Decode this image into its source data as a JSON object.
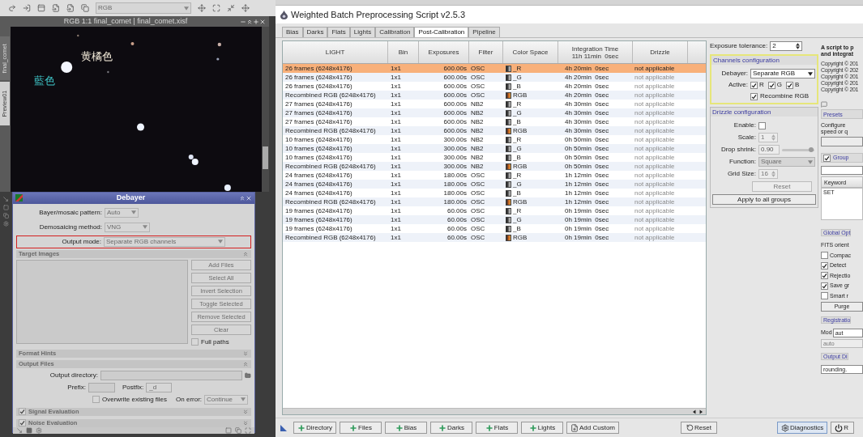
{
  "toolbar": {
    "view_selector": "RGB"
  },
  "image_window": {
    "title": "RGB 1:1 final_comet | final_comet.xisf",
    "side_tabs": [
      {
        "label": "final_comet",
        "selected": false
      },
      {
        "label": "Preview01",
        "selected": true
      }
    ],
    "annotations": [
      {
        "text": "黄橘色",
        "color": "#f2ead8"
      },
      {
        "text": "藍色",
        "color": "#3fc6c8"
      }
    ]
  },
  "debayer": {
    "title": "Debayer",
    "params": [
      {
        "label": "Bayer/mosaic pattern:",
        "value": "Auto",
        "highlighted": false
      },
      {
        "label": "Demosaicing method:",
        "value": "VNG",
        "highlighted": false
      },
      {
        "label": "Output mode:",
        "value": "Separate RGB channels",
        "highlighted": true
      }
    ],
    "target_images": {
      "title": "Target Images",
      "expanded": true,
      "buttons": [
        {
          "label": "Add Files",
          "disabled": true
        },
        {
          "label": "Select All",
          "disabled": true
        },
        {
          "label": "Invert Selection",
          "disabled": true
        },
        {
          "label": "Toggle Selected",
          "disabled": true
        },
        {
          "label": "Remove Selected",
          "disabled": true
        },
        {
          "label": "Clear",
          "disabled": true
        }
      ],
      "full_paths": {
        "label": "Full paths",
        "checked": false
      }
    },
    "format_hints": {
      "title": "Format Hints",
      "expanded": false
    },
    "output_files": {
      "title": "Output Files",
      "expanded": true,
      "directory_label": "Output directory:",
      "prefix_label": "Prefix:",
      "postfix_label": "Postfix:",
      "postfix_value": "_d",
      "overwrite": {
        "label": "Overwrite existing files",
        "checked": false
      },
      "on_error_label": "On error:",
      "on_error_value": "Continue"
    },
    "evaluations": [
      {
        "title": "Signal Evaluation",
        "checked": true,
        "expanded": false
      },
      {
        "title": "Noise Evaluation",
        "checked": true,
        "expanded": false
      }
    ]
  },
  "main_window": {
    "title": "Weighted Batch Preprocessing Script v2.5.3",
    "tabs": [
      {
        "label": "Bias",
        "selected": false
      },
      {
        "label": "Darks",
        "selected": false
      },
      {
        "label": "Flats",
        "selected": false
      },
      {
        "label": "Lights",
        "selected": false
      },
      {
        "label": "Calibration",
        "selected": false
      },
      {
        "label": "Post-Calibration",
        "selected": true
      },
      {
        "label": "Pipeline",
        "selected": false
      }
    ],
    "table": {
      "columns": [
        "LIGHT",
        "Bin",
        "Exposures",
        "Filter",
        "Color Space",
        "Integration Time",
        "Drizzle"
      ],
      "total_integration": "11h 11min  0sec",
      "rows": [
        {
          "light": "26 frames (6248x4176)",
          "bin": "1x1",
          "exposure": "600.00s",
          "filter": "OSC",
          "kind": "mono",
          "space": "_R",
          "integration": "4h 20min  0sec",
          "drizzle": "not applicable",
          "selected": true
        },
        {
          "light": "26 frames (6248x4176)",
          "bin": "1x1",
          "exposure": "600.00s",
          "filter": "OSC",
          "kind": "mono",
          "space": "_G",
          "integration": "4h 20min  0sec",
          "drizzle": "not applicable",
          "selected": false
        },
        {
          "light": "26 frames (6248x4176)",
          "bin": "1x1",
          "exposure": "600.00s",
          "filter": "OSC",
          "kind": "mono",
          "space": "_B",
          "integration": "4h 20min  0sec",
          "drizzle": "not applicable",
          "selected": false
        },
        {
          "light": "Recombined RGB (6248x4176)",
          "bin": "1x1",
          "exposure": "600.00s",
          "filter": "OSC",
          "kind": "rgb",
          "space": "RGB",
          "integration": "4h 20min  0sec",
          "drizzle": "not applicable",
          "selected": false
        },
        {
          "light": "27 frames (6248x4176)",
          "bin": "1x1",
          "exposure": "600.00s",
          "filter": "NB2",
          "kind": "mono",
          "space": "_R",
          "integration": "4h 30min  0sec",
          "drizzle": "not applicable",
          "selected": false
        },
        {
          "light": "27 frames (6248x4176)",
          "bin": "1x1",
          "exposure": "600.00s",
          "filter": "NB2",
          "kind": "mono",
          "space": "_G",
          "integration": "4h 30min  0sec",
          "drizzle": "not applicable",
          "selected": false
        },
        {
          "light": "27 frames (6248x4176)",
          "bin": "1x1",
          "exposure": "600.00s",
          "filter": "NB2",
          "kind": "mono",
          "space": "_B",
          "integration": "4h 30min  0sec",
          "drizzle": "not applicable",
          "selected": false
        },
        {
          "light": "Recombined RGB (6248x4176)",
          "bin": "1x1",
          "exposure": "600.00s",
          "filter": "NB2",
          "kind": "rgb",
          "space": "RGB",
          "integration": "4h 30min  0sec",
          "drizzle": "not applicable",
          "selected": false
        },
        {
          "light": "10 frames (6248x4176)",
          "bin": "1x1",
          "exposure": "300.00s",
          "filter": "NB2",
          "kind": "mono",
          "space": "_R",
          "integration": "0h 50min  0sec",
          "drizzle": "not applicable",
          "selected": false
        },
        {
          "light": "10 frames (6248x4176)",
          "bin": "1x1",
          "exposure": "300.00s",
          "filter": "NB2",
          "kind": "mono",
          "space": "_G",
          "integration": "0h 50min  0sec",
          "drizzle": "not applicable",
          "selected": false
        },
        {
          "light": "10 frames (6248x4176)",
          "bin": "1x1",
          "exposure": "300.00s",
          "filter": "NB2",
          "kind": "mono",
          "space": "_B",
          "integration": "0h 50min  0sec",
          "drizzle": "not applicable",
          "selected": false
        },
        {
          "light": "Recombined RGB (6248x4176)",
          "bin": "1x1",
          "exposure": "300.00s",
          "filter": "NB2",
          "kind": "rgb",
          "space": "RGB",
          "integration": "0h 50min  0sec",
          "drizzle": "not applicable",
          "selected": false
        },
        {
          "light": "24 frames (6248x4176)",
          "bin": "1x1",
          "exposure": "180.00s",
          "filter": "OSC",
          "kind": "mono",
          "space": "_R",
          "integration": "1h 12min  0sec",
          "drizzle": "not applicable",
          "selected": false
        },
        {
          "light": "24 frames (6248x4176)",
          "bin": "1x1",
          "exposure": "180.00s",
          "filter": "OSC",
          "kind": "mono",
          "space": "_G",
          "integration": "1h 12min  0sec",
          "drizzle": "not applicable",
          "selected": false
        },
        {
          "light": "24 frames (6248x4176)",
          "bin": "1x1",
          "exposure": "180.00s",
          "filter": "OSC",
          "kind": "mono",
          "space": "_B",
          "integration": "1h 12min  0sec",
          "drizzle": "not applicable",
          "selected": false
        },
        {
          "light": "Recombined RGB (6248x4176)",
          "bin": "1x1",
          "exposure": "180.00s",
          "filter": "OSC",
          "kind": "rgb",
          "space": "RGB",
          "integration": "1h 12min  0sec",
          "drizzle": "not applicable",
          "selected": false
        },
        {
          "light": "19 frames (6248x4176)",
          "bin": "1x1",
          "exposure": "60.00s",
          "filter": "OSC",
          "kind": "mono",
          "space": "_R",
          "integration": "0h 19min  0sec",
          "drizzle": "not applicable",
          "selected": false
        },
        {
          "light": "19 frames (6248x4176)",
          "bin": "1x1",
          "exposure": "60.00s",
          "filter": "OSC",
          "kind": "mono",
          "space": "_G",
          "integration": "0h 19min  0sec",
          "drizzle": "not applicable",
          "selected": false
        },
        {
          "light": "19 frames (6248x4176)",
          "bin": "1x1",
          "exposure": "60.00s",
          "filter": "OSC",
          "kind": "mono",
          "space": "_B",
          "integration": "0h 19min  0sec",
          "drizzle": "not applicable",
          "selected": false
        },
        {
          "light": "Recombined RGB (6248x4176)",
          "bin": "1x1",
          "exposure": "60.00s",
          "filter": "OSC",
          "kind": "rgb",
          "space": "RGB",
          "integration": "0h 19min  0sec",
          "drizzle": "not applicable",
          "selected": false
        }
      ]
    },
    "exposure_tolerance": {
      "label": "Exposure tolerance:",
      "value": "2"
    },
    "channels": {
      "title": "Channels configuration",
      "highlighted": true,
      "debayer_label": "Debayer:",
      "debayer_value": "Separate RGB",
      "active_label": "Active:",
      "channels": [
        {
          "label": "R",
          "checked": true
        },
        {
          "label": "G",
          "checked": true
        },
        {
          "label": "B",
          "checked": true
        }
      ],
      "recombine": {
        "label": "Recombine RGB",
        "checked": true
      }
    },
    "drizzle": {
      "title": "Drizzle configuration",
      "enable_label": "Enable:",
      "enabled": false,
      "fields": [
        {
          "label": "Scale:",
          "value": "1",
          "kind": "spin"
        },
        {
          "label": "Drop shrink:",
          "value": "0.90",
          "kind": "slider",
          "level": 0.9
        },
        {
          "label": "Function:",
          "value": "Square",
          "kind": "select"
        },
        {
          "label": "Grid Size:",
          "value": "16",
          "kind": "spin"
        }
      ],
      "reset": {
        "label": "Reset",
        "disabled": true
      },
      "apply": "Apply to all groups"
    },
    "side_column": {
      "intro": [
        "A script to p",
        "and integrat"
      ],
      "copyright": [
        "Copyright © 201",
        "Copyright © 202",
        "Copyright © 201",
        "Copyright © 201",
        "Copyright © 201"
      ],
      "presets": {
        "title": "Presets",
        "text": [
          "Configure",
          "speed or q"
        ]
      },
      "groups": {
        "label": "Group",
        "checked": true,
        "keyword_header": "Keyword",
        "items": [
          "SET"
        ]
      },
      "global_options": {
        "title": "Global Opt",
        "fits_label": "FITS orient",
        "options": [
          {
            "label": "Compac",
            "checked": false
          },
          {
            "label": "Detect",
            "checked": true
          },
          {
            "label": "Rejectio",
            "checked": true
          },
          {
            "label": "Save gr",
            "checked": true
          },
          {
            "label": "Smart r",
            "checked": false
          }
        ],
        "purge": "Purge"
      },
      "registration": {
        "title": "Registratio",
        "mode_label": "Mod",
        "mode_value": "aut",
        "field_value": "auto"
      },
      "output_dir": {
        "title": "Output Di",
        "value": "rounding."
      }
    },
    "bottom_buttons": [
      {
        "label": "Directory",
        "kind": "add"
      },
      {
        "label": "Files",
        "kind": "add"
      },
      {
        "label": "Bias",
        "kind": "add"
      },
      {
        "label": "Darks",
        "kind": "add"
      },
      {
        "label": "Flats",
        "kind": "add"
      },
      {
        "label": "Lights",
        "kind": "add"
      },
      {
        "label": "Add Custom",
        "kind": "custom"
      }
    ],
    "reset_button": "Reset",
    "diagnostics_button": "Diagnostics",
    "run_button": "R"
  }
}
